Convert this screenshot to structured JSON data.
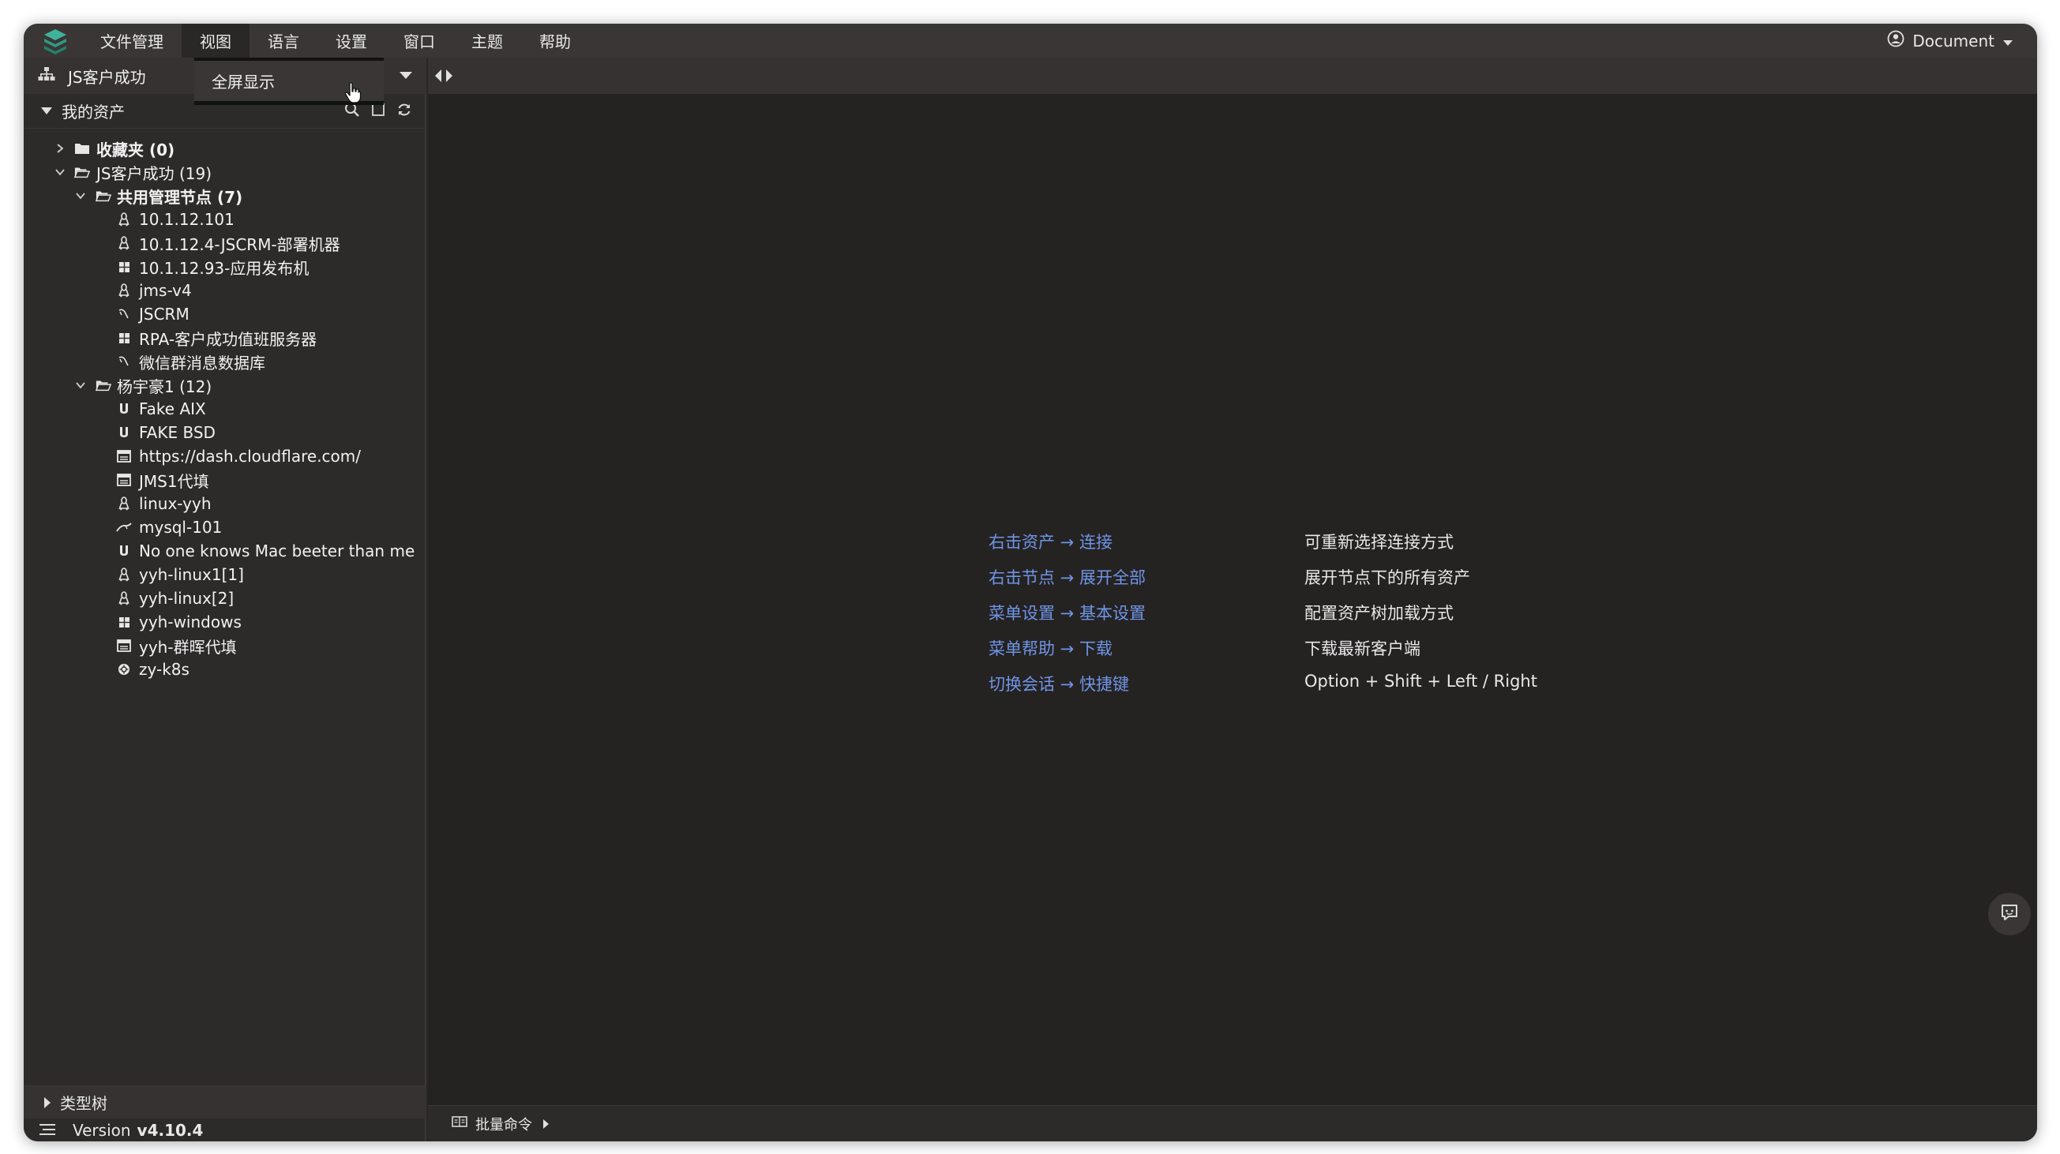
{
  "menubar": {
    "items": [
      "文件管理",
      "视图",
      "语言",
      "设置",
      "窗口",
      "主题",
      "帮助"
    ],
    "active_index": 1,
    "user": "Document"
  },
  "dropdown": {
    "option": "全屏显示"
  },
  "org": {
    "name": "JS客户成功"
  },
  "assets": {
    "label": "我的资产",
    "tree": [
      {
        "label": "收藏夹 (0)",
        "bold": true,
        "level": 0,
        "toggle": "collapsed",
        "icon": "folder-closed-icon"
      },
      {
        "label": "JS客户成功 (19)",
        "bold": false,
        "level": 0,
        "toggle": "expanded",
        "icon": "folder-open-icon"
      },
      {
        "label": "共用管理节点 (7)",
        "bold": true,
        "level": 1,
        "toggle": "expanded",
        "icon": "folder-open-icon"
      },
      {
        "label": "10.1.12.101",
        "bold": false,
        "level": 2,
        "toggle": "none",
        "icon": "linux-icon"
      },
      {
        "label": "10.1.12.4-JSCRM-部署机器",
        "bold": false,
        "level": 2,
        "toggle": "none",
        "icon": "linux-icon"
      },
      {
        "label": "10.1.12.93-应用发布机",
        "bold": false,
        "level": 2,
        "toggle": "none",
        "icon": "windows-icon"
      },
      {
        "label": "jms-v4",
        "bold": false,
        "level": 2,
        "toggle": "none",
        "icon": "linux-icon"
      },
      {
        "label": "JSCRM",
        "bold": false,
        "level": 2,
        "toggle": "none",
        "icon": "database-icon"
      },
      {
        "label": "RPA-客户成功值班服务器",
        "bold": false,
        "level": 2,
        "toggle": "none",
        "icon": "windows-icon"
      },
      {
        "label": "微信群消息数据库",
        "bold": false,
        "level": 2,
        "toggle": "none",
        "icon": "database-icon"
      },
      {
        "label": "杨宇豪1 (12)",
        "bold": false,
        "level": 1,
        "toggle": "expanded",
        "icon": "folder-open-icon"
      },
      {
        "label": "Fake AIX",
        "bold": false,
        "level": 2,
        "toggle": "none",
        "icon": "unix-icon"
      },
      {
        "label": "FAKE BSD",
        "bold": false,
        "level": 2,
        "toggle": "none",
        "icon": "unix-icon"
      },
      {
        "label": "https://dash.cloudflare.com/",
        "bold": false,
        "level": 2,
        "toggle": "none",
        "icon": "web-icon"
      },
      {
        "label": "JMS1代填",
        "bold": false,
        "level": 2,
        "toggle": "none",
        "icon": "web-icon"
      },
      {
        "label": "linux-yyh",
        "bold": false,
        "level": 2,
        "toggle": "none",
        "icon": "linux-icon"
      },
      {
        "label": "mysql-101",
        "bold": false,
        "level": 2,
        "toggle": "none",
        "icon": "mysql-icon"
      },
      {
        "label": "No one knows Mac beeter than me",
        "bold": false,
        "level": 2,
        "toggle": "none",
        "icon": "unix-icon"
      },
      {
        "label": "yyh-linux1[1]",
        "bold": false,
        "level": 2,
        "toggle": "none",
        "icon": "linux-icon"
      },
      {
        "label": "yyh-linux[2]",
        "bold": false,
        "level": 2,
        "toggle": "none",
        "icon": "linux-icon"
      },
      {
        "label": "yyh-windows",
        "bold": false,
        "level": 2,
        "toggle": "none",
        "icon": "windows-icon"
      },
      {
        "label": "yyh-群晖代填",
        "bold": false,
        "level": 2,
        "toggle": "none",
        "icon": "web-icon"
      },
      {
        "label": "zy-k8s",
        "bold": false,
        "level": 2,
        "toggle": "none",
        "icon": "k8s-icon"
      }
    ]
  },
  "type_tree": {
    "label": "类型树"
  },
  "version": {
    "prefix": "Version",
    "value": "v4.10.4"
  },
  "help": [
    {
      "action": "右击资产 → 连接",
      "desc": "可重新选择连接方式"
    },
    {
      "action": "右击节点 → 展开全部",
      "desc": "展开节点下的所有资产"
    },
    {
      "action": "菜单设置 → 基本设置",
      "desc": "配置资产树加载方式"
    },
    {
      "action": "菜单帮助 → 下载",
      "desc": "下载最新客户端"
    },
    {
      "action": "切换会话 → 快捷键",
      "desc": "Option + Shift + Left / Right"
    }
  ],
  "bottom": {
    "batch_command": "批量命令"
  },
  "colors": {
    "accent_link": "#6f95e6",
    "logo": "#3fb39a"
  }
}
